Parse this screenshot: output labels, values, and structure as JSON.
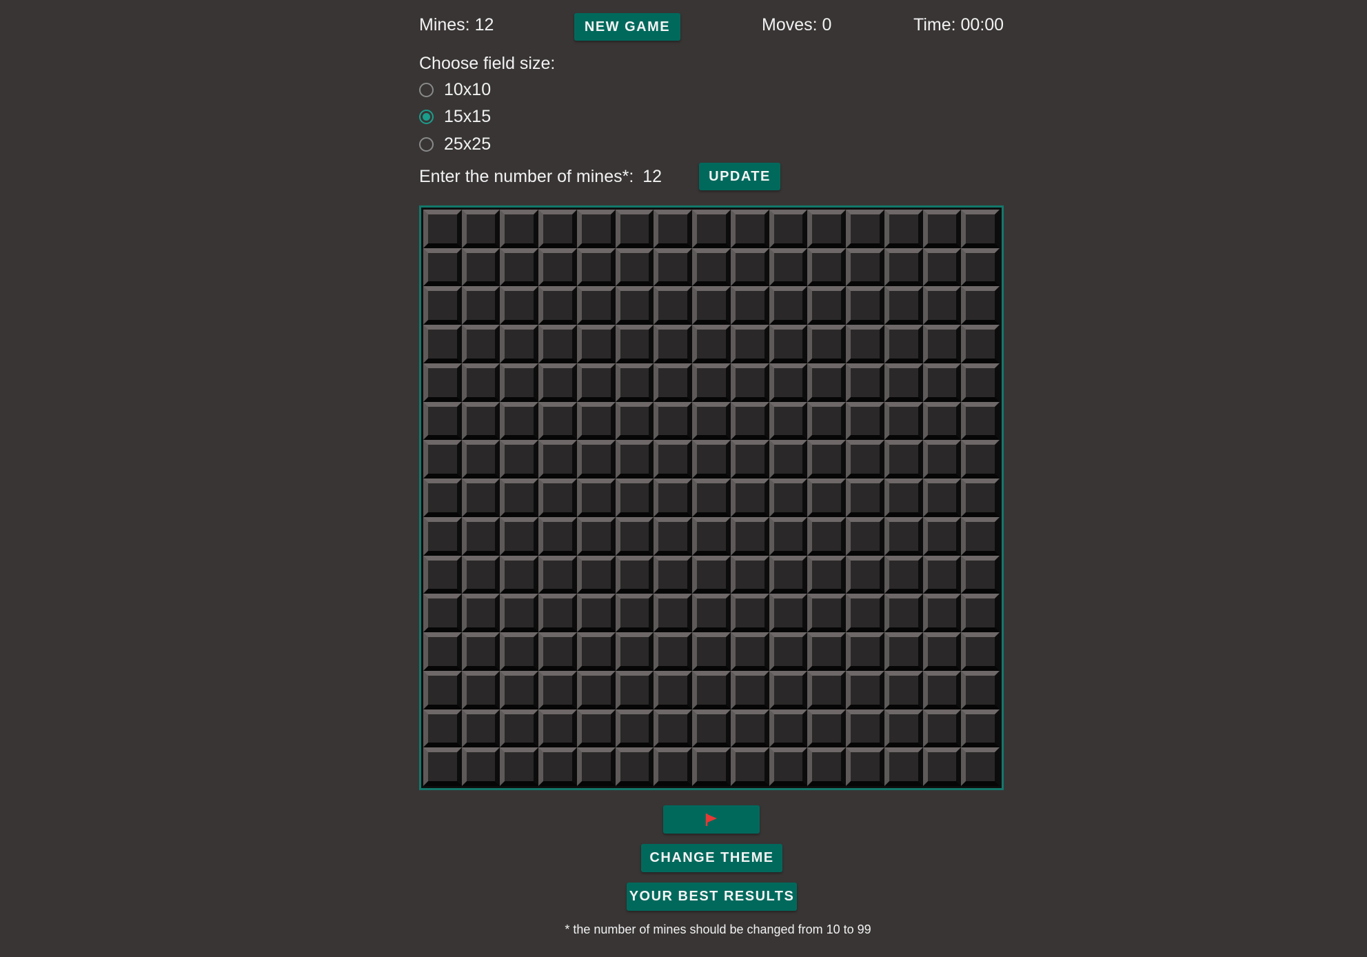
{
  "header": {
    "mines_label": "Mines: 12",
    "new_game_label": "NEW GAME",
    "moves_label": "Moves: 0",
    "time_label": "Time: 00:00"
  },
  "field_size": {
    "prompt": "Choose field size:",
    "options": [
      {
        "label": "10x10",
        "selected": false
      },
      {
        "label": "15x15",
        "selected": true
      },
      {
        "label": "25x25",
        "selected": false
      }
    ]
  },
  "mines_input": {
    "label": "Enter the number of mines*:",
    "value": "12",
    "update_label": "UPDATE"
  },
  "board": {
    "rows": 15,
    "cols": 15,
    "state": "all-closed"
  },
  "controls": {
    "flag_icon": "flag-icon",
    "change_theme_label": "CHANGE THEME",
    "best_results_label": "YOUR BEST RESULTS"
  },
  "footnote": "* the number of mines should be changed from 10 to 99",
  "colors": {
    "background": "#393535",
    "accent": "#00695c",
    "board_border": "#13786b",
    "flag": "#e53935"
  }
}
